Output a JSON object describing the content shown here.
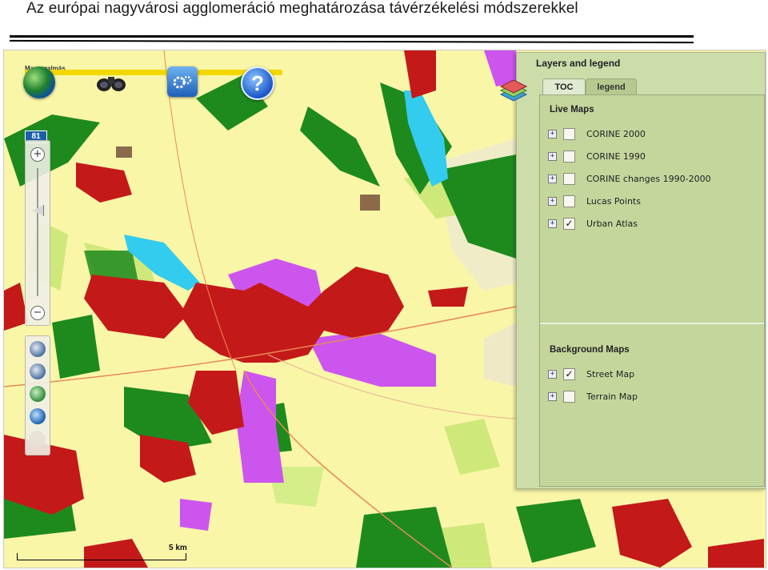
{
  "slide": {
    "title": "Az európai nagyvárosi agglomeráció meghatározása távérzékelési módszerekkel"
  },
  "map": {
    "place_label": "Magyaralmás",
    "road_shield": "81",
    "scale_label": "5 km",
    "toolbar": {
      "buttons": [
        "globe-icon",
        "binoculars-icon",
        "settings-icon",
        "help-icon"
      ],
      "help_glyph": "?"
    },
    "zoom": {
      "in_glyph": "+",
      "out_glyph": "−"
    },
    "tools": [
      "zoom-in-icon",
      "zoom-out-icon",
      "zoom-extent-icon",
      "full-extent-icon",
      "pan-hand-icon"
    ],
    "colors": {
      "background": "#faf6a8",
      "urban": "#c41919",
      "industrial": "#cc55ee",
      "forest": "#1e8a1e",
      "pasture": "#cfe87a",
      "water": "#33ccee",
      "road": "#e88a55"
    }
  },
  "layers_panel": {
    "title": "Layers and legend",
    "tabs": [
      {
        "label": "TOC",
        "active": true
      },
      {
        "label": "legend",
        "active": false
      }
    ],
    "live_maps": {
      "title": "Live Maps",
      "items": [
        {
          "label": "CORINE 2000",
          "checked": false
        },
        {
          "label": "CORINE 1990",
          "checked": false
        },
        {
          "label": "CORINE changes 1990-2000",
          "checked": false
        },
        {
          "label": "Lucas Points",
          "checked": false
        },
        {
          "label": "Urban Atlas",
          "checked": true
        }
      ]
    },
    "background_maps": {
      "title": "Background Maps",
      "items": [
        {
          "label": "Street Map",
          "checked": true
        },
        {
          "label": "Terrain Map",
          "checked": false
        }
      ]
    },
    "expand_glyph": "+",
    "check_glyph": "✓"
  }
}
